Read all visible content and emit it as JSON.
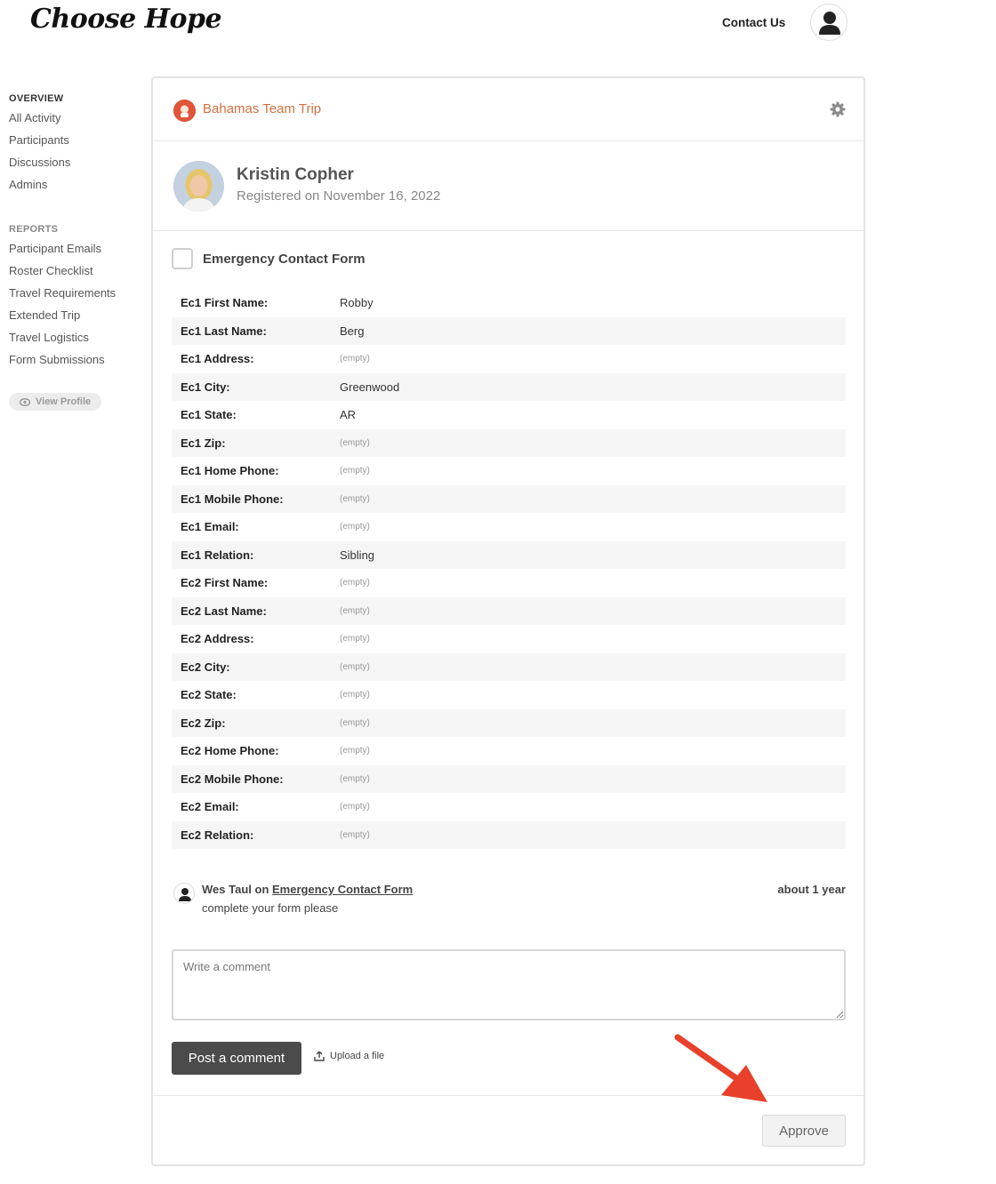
{
  "header": {
    "logo_text": "Choose Hope",
    "contact_label": "Contact Us"
  },
  "sidebar": {
    "overview_heading": "OVERVIEW",
    "overview_items": [
      "All Activity",
      "Participants",
      "Discussions",
      "Admins"
    ],
    "reports_heading": "REPORTS",
    "report_items": [
      "Participant Emails",
      "Roster Checklist",
      "Travel Requirements",
      "Extended Trip",
      "Travel Logistics",
      "Form Submissions"
    ],
    "view_profile_label": "View Profile"
  },
  "trip": {
    "title": "Bahamas Team Trip",
    "accent_color": "#d2703e"
  },
  "participant": {
    "name": "Kristin Copher",
    "registered": "Registered on November 16, 2022"
  },
  "form": {
    "title": "Emergency Contact Form",
    "fields": [
      {
        "label": "Ec1 First Name:",
        "value": "Robby"
      },
      {
        "label": "Ec1 Last Name:",
        "value": "Berg"
      },
      {
        "label": "Ec1 Address:",
        "value": "(empty)"
      },
      {
        "label": "Ec1 City:",
        "value": "Greenwood"
      },
      {
        "label": "Ec1 State:",
        "value": "AR"
      },
      {
        "label": "Ec1 Zip:",
        "value": "(empty)"
      },
      {
        "label": "Ec1 Home Phone:",
        "value": "(empty)"
      },
      {
        "label": "Ec1 Mobile Phone:",
        "value": "(empty)"
      },
      {
        "label": "Ec1 Email:",
        "value": "(empty)"
      },
      {
        "label": "Ec1 Relation:",
        "value": "Sibling"
      },
      {
        "label": "Ec2 First Name:",
        "value": "(empty)"
      },
      {
        "label": "Ec2 Last Name:",
        "value": "(empty)"
      },
      {
        "label": "Ec2 Address:",
        "value": "(empty)"
      },
      {
        "label": "Ec2 City:",
        "value": "(empty)"
      },
      {
        "label": "Ec2 State:",
        "value": "(empty)"
      },
      {
        "label": "Ec2 Zip:",
        "value": "(empty)"
      },
      {
        "label": "Ec2 Home Phone:",
        "value": "(empty)"
      },
      {
        "label": "Ec2 Mobile Phone:",
        "value": "(empty)"
      },
      {
        "label": "Ec2 Email:",
        "value": "(empty)"
      },
      {
        "label": "Ec2 Relation:",
        "value": "(empty)"
      }
    ]
  },
  "comment": {
    "author": "Wes Taul",
    "on_word": "on",
    "link_text": "Emergency Contact Form",
    "time": "about 1 year",
    "body": "complete your form please"
  },
  "composer": {
    "placeholder": "Write a comment",
    "post_label": "Post a comment",
    "upload_label": "Upload a file"
  },
  "actions": {
    "approve_label": "Approve",
    "arrow_color": "#e8402a"
  }
}
